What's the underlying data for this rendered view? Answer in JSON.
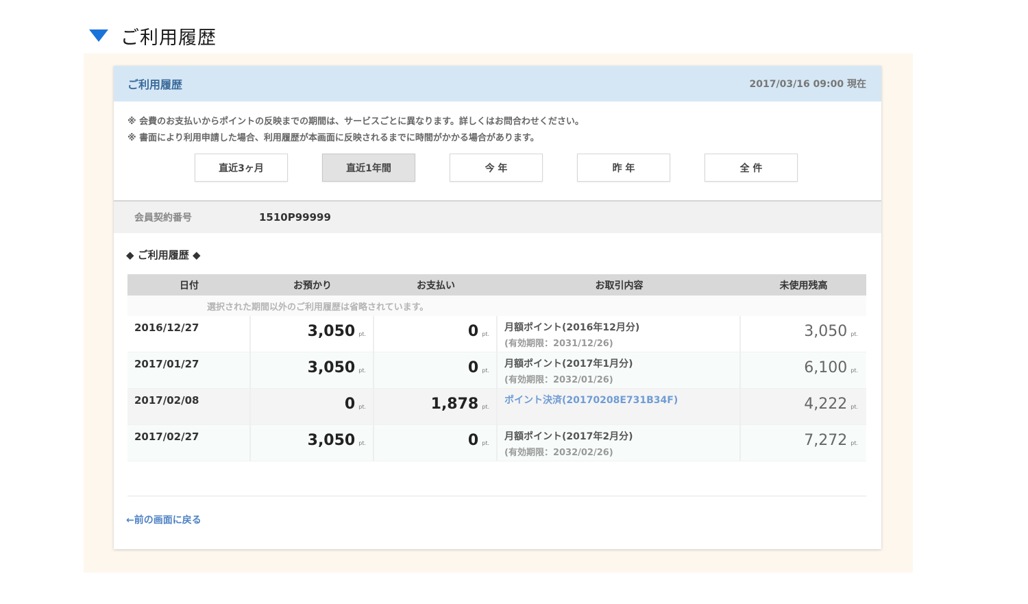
{
  "page": {
    "title": "ご利用履歴"
  },
  "card": {
    "title": "ご利用履歴",
    "as_of": "2017/03/16 09:00 現在",
    "notes": [
      "※ 会費のお支払いからポイントの反映までの期間は、サービスごとに異なります。詳しくはお問合わせください。",
      "※ 書面により利用申請した場合、利用履歴が本画面に反映されるまでに時間がかかる場合があります。"
    ],
    "filters": [
      "直近3ヶ月",
      "直近1年間",
      "今 年",
      "昨 年",
      "全 件"
    ],
    "selected_filter": "直近1年間"
  },
  "member": {
    "label": "会員契約番号",
    "value": "1510P99999"
  },
  "history": {
    "section_title": "◆ ご利用履歴 ◆",
    "columns": [
      "日付",
      "お預かり",
      "お支払い",
      "お取引内容",
      "未使用残高"
    ],
    "omitted_note": "選択された期間以外のご利用履歴は省略されています。",
    "unit": "pt.",
    "rows": [
      {
        "date": "2016/12/27",
        "deposit": "3,050",
        "payment": "0",
        "desc": "月額ポイント(2016年12月分)",
        "desc_sub": "(有効期限：2031/12/26)",
        "balance": "3,050"
      },
      {
        "date": "2017/01/27",
        "deposit": "3,050",
        "payment": "0",
        "desc": "月額ポイント(2017年1月分)",
        "desc_sub": "(有効期限：2032/01/26)",
        "balance": "6,100"
      },
      {
        "date": "2017/02/08",
        "deposit": "0",
        "payment": "1,878",
        "desc": "ポイント決済(20170208E731B34F)",
        "desc_sub": "",
        "balance": "4,222"
      },
      {
        "date": "2017/02/27",
        "deposit": "3,050",
        "payment": "0",
        "desc": "月額ポイント(2017年2月分)",
        "desc_sub": "(有効期限：2032/02/26)",
        "balance": "7,272"
      }
    ]
  },
  "footer": {
    "back_link": "←前の画面に戻る"
  },
  "colors": {
    "accent_blue": "#1a73d9",
    "header_bg": "#d5e7f5",
    "link": "#4e82c4"
  }
}
